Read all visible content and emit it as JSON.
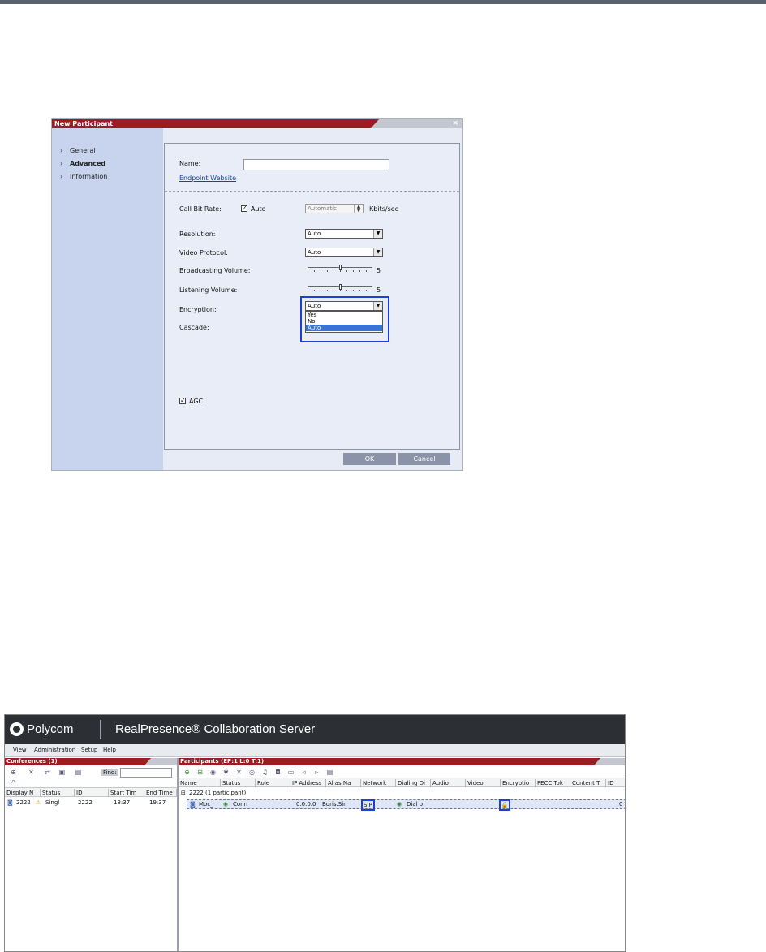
{
  "dialog": {
    "title": "New Participant",
    "close_label": "×",
    "nav": [
      {
        "label": "General",
        "active": false
      },
      {
        "label": "Advanced",
        "active": true
      },
      {
        "label": "Information",
        "active": false
      }
    ],
    "name_label": "Name:",
    "name_value": "",
    "endpoint_link": "Endpoint Website",
    "call_bit_rate_label": "Call Bit Rate:",
    "auto_label": "Auto",
    "auto_checked": true,
    "bitrate_value": "Automatic",
    "bitrate_unit": "Kbits/sec",
    "resolution_label": "Resolution:",
    "resolution_value": "Auto",
    "video_protocol_label": "Video Protocol:",
    "video_protocol_value": "Auto",
    "broadcasting_label": "Broadcasting Volume:",
    "broadcasting_value": "5",
    "broadcasting_level": 0.5,
    "listening_label": "Listening Volume:",
    "listening_value": "5",
    "listening_level": 0.5,
    "encryption_label": "Encryption:",
    "encryption_value": "Auto",
    "encryption_options": [
      "Yes",
      "No",
      "Auto"
    ],
    "encryption_selected": "Auto",
    "cascade_label": "Cascade:",
    "agc_label": "AGC",
    "agc_checked": true,
    "ok_label": "OK",
    "cancel_label": "Cancel",
    "highlight_color": "#1f3fd6",
    "title_color": "#9c1c20"
  },
  "app": {
    "brand": "Polycom",
    "title": "RealPresence® Collaboration Server",
    "menu": [
      "View",
      "Administration",
      "Setup",
      "Help"
    ],
    "conferences": {
      "title": "Conferences (1)",
      "find_label": "Find:",
      "columns": [
        "Display N",
        "Status",
        "ID",
        "Start Tim",
        "End Time"
      ],
      "rows": [
        {
          "name": "2222",
          "status": "Singl",
          "id": "2222",
          "start": "18:37",
          "end": "19:37"
        }
      ]
    },
    "participants": {
      "title": "Participants (EP:1 L:0 T:1)",
      "columns": [
        "Name",
        "Status",
        "Role",
        "IP Address",
        "Alias Na",
        "Network",
        "Dialing Di",
        "Audio",
        "Video",
        "Encryptio",
        "FECC Tok",
        "Content T",
        "ID"
      ],
      "group": "2222 (1  participant)",
      "rows": [
        {
          "name": "Moc_",
          "status": "Conn",
          "role": "",
          "ip": "0.0.0.0",
          "alias": "Boris.Sir",
          "network": "SIP",
          "dialing": "Dial o",
          "audio": "",
          "video": "",
          "encryption": "lock-icon",
          "fecc": "",
          "content": "",
          "id": "0"
        }
      ]
    }
  }
}
